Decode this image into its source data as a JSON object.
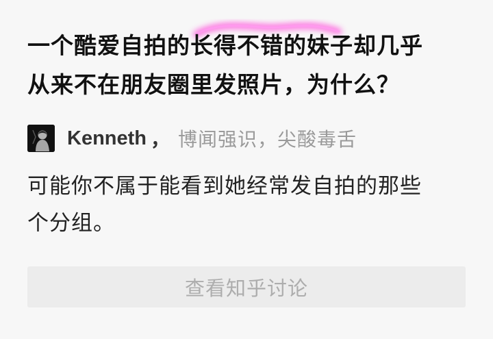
{
  "question": {
    "line1": "一个酷爱自拍的长得不错的妹子却几乎",
    "line2": "从来不在朋友圈里发照片，为什么？"
  },
  "author": {
    "avatar_icon": "portrait-avatar-icon",
    "name": "Kenneth",
    "separator": "，",
    "bio": "博闻强识，尖酸毒舌"
  },
  "answer": {
    "line1": "可能你不属于能看到她经常发自拍的那些",
    "line2": "个分组。"
  },
  "action": {
    "discuss_label": "查看知乎讨论"
  },
  "colors": {
    "highlight": "#ff3fd8",
    "muted": "#9a9a9a",
    "button_bg": "#ececec"
  }
}
